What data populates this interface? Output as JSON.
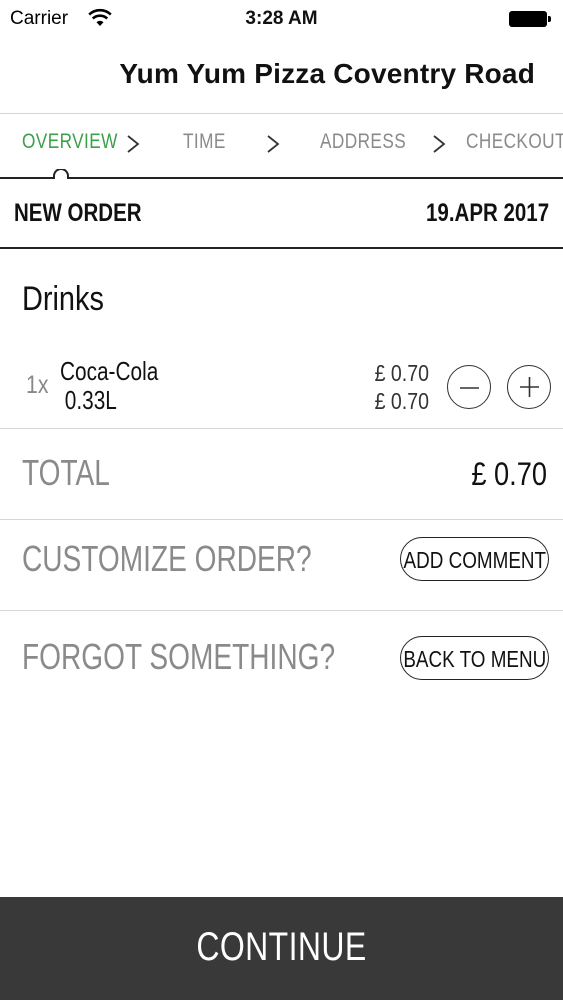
{
  "status_bar": {
    "carrier": "Carrier",
    "time": "3:28 AM"
  },
  "header": {
    "title": "Yum Yum Pizza Coventry Road"
  },
  "steps": [
    {
      "label": "OVERVIEW",
      "active": true
    },
    {
      "label": "TIME",
      "active": false
    },
    {
      "label": "ADDRESS",
      "active": false
    },
    {
      "label": "CHECKOUT",
      "active": false
    }
  ],
  "order": {
    "label": "NEW ORDER",
    "date": "19.APR 2017"
  },
  "section": {
    "title": "Drinks"
  },
  "items": [
    {
      "qty": "1x",
      "name_line1": "Coca-Cola",
      "name_line2": "0.33L",
      "unit_price": "£ 0.70",
      "line_price": "£ 0.70"
    }
  ],
  "total": {
    "label": "TOTAL",
    "value": "£ 0.70"
  },
  "customize": {
    "label": "CUSTOMIZE ORDER?",
    "button": "ADD COMMENT"
  },
  "forgot": {
    "label": "FORGOT SOMETHING?",
    "button": "BACK TO MENU"
  },
  "footer": {
    "continue_label": "CONTINUE"
  },
  "colors": {
    "accent": "#3aa14a",
    "footer_bg": "#3a3939",
    "muted": "#8a8a8a"
  }
}
